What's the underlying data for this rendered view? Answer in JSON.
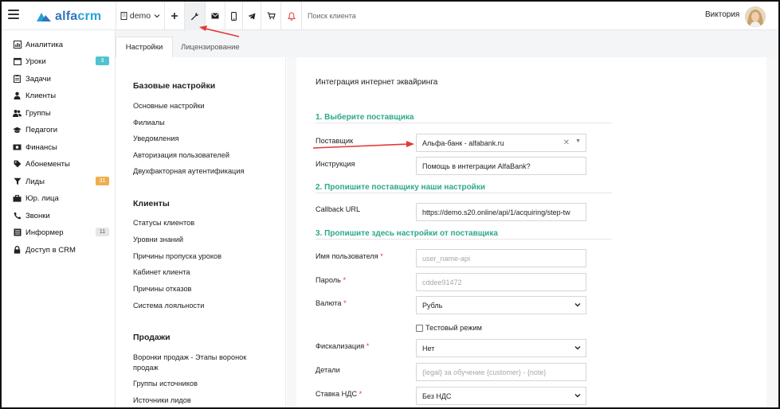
{
  "topbar": {
    "logo_text": "alfa",
    "logo_text_accent": "crm",
    "branch": "demo",
    "search_placeholder": "Поиск клиента",
    "user_name": "Виктория"
  },
  "sidebar": {
    "items": [
      {
        "label": "Аналитика",
        "icon": "chart-icon"
      },
      {
        "label": "Уроки",
        "icon": "calendar-icon",
        "badge": "3",
        "badge_color": "#4fc3d0"
      },
      {
        "label": "Задачи",
        "icon": "clipboard-icon"
      },
      {
        "label": "Клиенты",
        "icon": "user-icon"
      },
      {
        "label": "Группы",
        "icon": "users-icon"
      },
      {
        "label": "Педагоги",
        "icon": "graduation-cap-icon"
      },
      {
        "label": "Финансы",
        "icon": "money-icon"
      },
      {
        "label": "Абонементы",
        "icon": "tag-icon"
      },
      {
        "label": "Лиды",
        "icon": "funnel-icon",
        "badge": "31",
        "badge_color": "#f0ad4e"
      },
      {
        "label": "Юр. лица",
        "icon": "briefcase-icon"
      },
      {
        "label": "Звонки",
        "icon": "phone-icon"
      },
      {
        "label": "Информер",
        "icon": "list-icon",
        "badge": "11",
        "badge_color": "#e6e6e6"
      },
      {
        "label": "Доступ в CRM",
        "icon": "lock-icon"
      }
    ]
  },
  "tabs": [
    {
      "label": "Настройки",
      "active": true
    },
    {
      "label": "Лицензирование",
      "active": false
    }
  ],
  "settings_nav": {
    "groups": [
      {
        "title": "Базовые настройки",
        "links": [
          "Основные настройки",
          "Филиалы",
          "Уведомления",
          "Авторизация пользователей",
          "Двухфакторная аутентификация"
        ]
      },
      {
        "title": "Клиенты",
        "links": [
          "Статусы клиентов",
          "Уровни знаний",
          "Причины пропуска уроков",
          "Кабинет клиента",
          "Причины отказов",
          "Система лояльности"
        ]
      },
      {
        "title": "Продажи",
        "links": [
          "Воронки продаж - Этапы воронок продаж",
          "Группы источников",
          "Источники лидов"
        ]
      }
    ]
  },
  "form": {
    "title": "Интеграция интернет эквайринга",
    "section1": "1. Выберите поставщика",
    "section2": "2. Пропишите поставщику наши настройки",
    "section3": "3. Пропишите здесь настройки от поставщика",
    "provider_label": "Поставщик",
    "provider_value": "Альфа-банк - alfabank.ru",
    "instruction_label": "Инструкция",
    "instruction_value": "Помощь в интеграции AlfaBank?",
    "callback_label": "Callback URL",
    "callback_value": "https://demo.s20.online/api/1/acquiring/step-tw",
    "username_label": "Имя пользователя",
    "username_placeholder": "user_name-api",
    "password_label": "Пароль",
    "password_placeholder": "cddee91472",
    "currency_label": "Валюта",
    "currency_value": "Рубль",
    "test_mode_label": "Тестовый режим",
    "fiscal_label": "Фискализация",
    "fiscal_value": "Нет",
    "details_label": "Детали",
    "details_placeholder": "{legal} за обучение {customer} - {note}",
    "vat_label": "Ставка НДС",
    "vat_value": "Без НДС",
    "required_mark": "*"
  },
  "colors": {
    "accent_green": "#2ea88a",
    "brand_blue": "#3574b8",
    "annotation_red": "#e53935"
  }
}
